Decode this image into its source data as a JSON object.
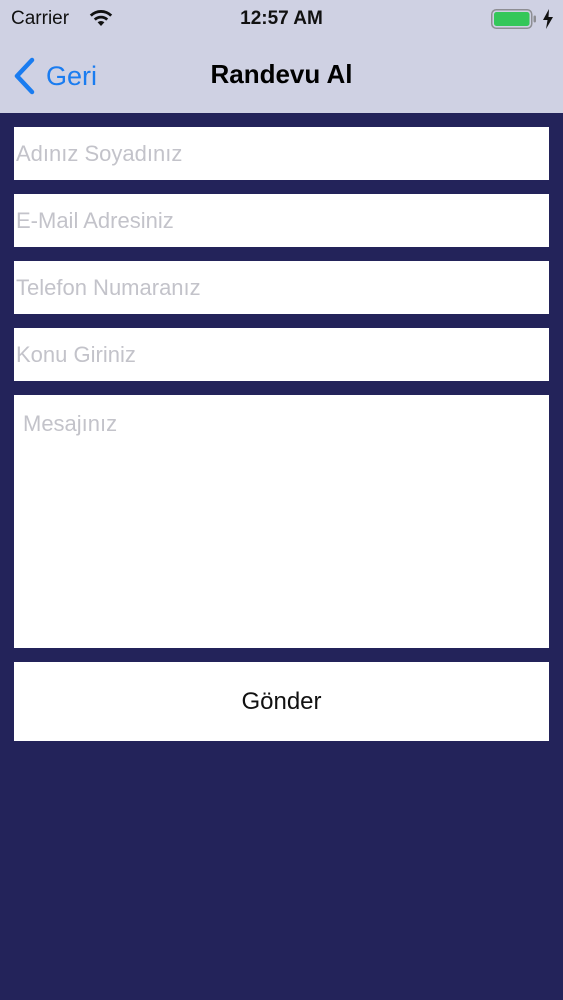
{
  "status_bar": {
    "carrier": "Carrier",
    "time": "12:57 AM",
    "wifi_icon": "wifi-icon",
    "battery_icon": "battery-icon",
    "charging_icon": "charging-bolt-icon",
    "battery_color": "#34c759"
  },
  "nav_bar": {
    "back_label": "Geri",
    "back_icon": "chevron-left-icon",
    "title": "Randevu Al",
    "accent_color": "#1a7cf0",
    "background": "#cfd1e3"
  },
  "form": {
    "name_placeholder": "Adınız Soyadınız",
    "email_placeholder": "E-Mail Adresiniz",
    "phone_placeholder": "Telefon Numaranız",
    "subject_placeholder": "Konu Giriniz",
    "message_placeholder": "Mesajınız",
    "submit_label": "Gönder",
    "background": "#23235a"
  }
}
